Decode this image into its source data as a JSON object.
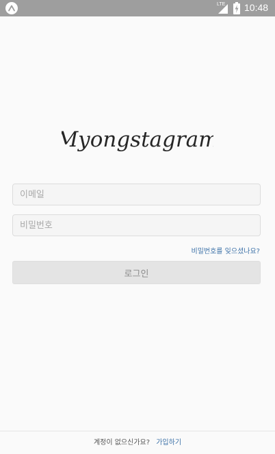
{
  "statusbar": {
    "app_icon": "expo-caret-icon",
    "network": "LTE",
    "signal_icon": "signal-icon",
    "battery_icon": "battery-charging-icon",
    "time": "10:48"
  },
  "logo": {
    "text": "Myongstagram"
  },
  "login_form": {
    "email_placeholder": "이메일",
    "password_placeholder": "비밀번호",
    "forgot_password": "비밀번호를 잊으셨나요?",
    "login_button": "로그인"
  },
  "footer": {
    "text": "계정이 없으신가요?",
    "signup_link": "가입하기"
  },
  "colors": {
    "statusbar": "#9e9e9e",
    "background": "#fafafa",
    "link": "#3d72a8",
    "button_bg": "#e4e4e4",
    "button_text": "#8c8c8c"
  }
}
